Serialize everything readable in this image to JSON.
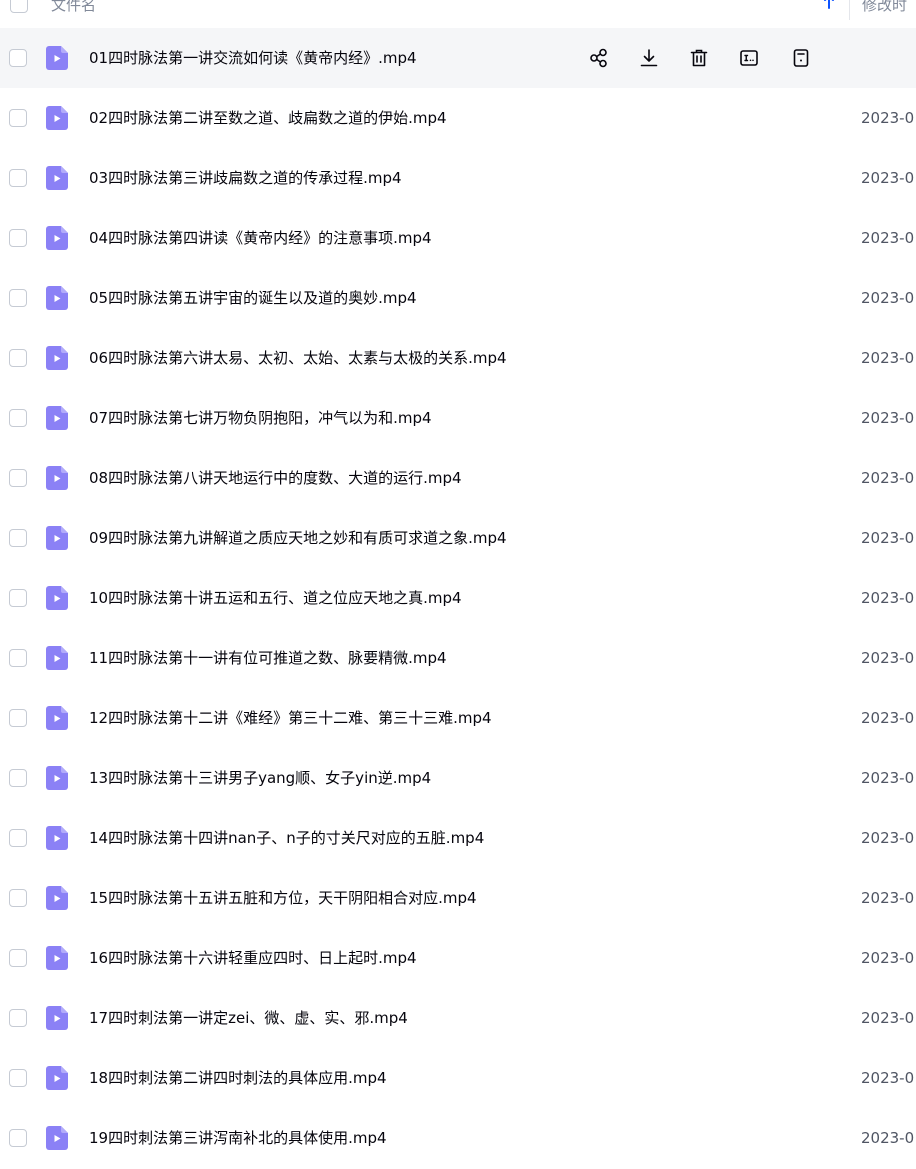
{
  "header": {
    "name_label": "文件名",
    "time_label": "修改时"
  },
  "colors": {
    "icon_bg": "#8b81f6",
    "accent": "#0d53ff",
    "hover_row": "#f5f6f8"
  },
  "icons": {
    "file": "video-file-icon",
    "share": "share-icon",
    "download": "download-icon",
    "delete": "trash-icon",
    "rename": "rename-icon",
    "more": "more-icon",
    "sort": "arrow-up-icon"
  },
  "files": [
    {
      "name": "01四时脉法第一讲交流如何读《黄帝内经》.mp4",
      "date": ""
    },
    {
      "name": "02四时脉法第二讲至数之道、歧扁数之道的伊始.mp4",
      "date": "2023-0"
    },
    {
      "name": "03四时脉法第三讲歧扁数之道的传承过程.mp4",
      "date": "2023-0"
    },
    {
      "name": "04四时脉法第四讲读《黄帝内经》的注意事项.mp4",
      "date": "2023-0"
    },
    {
      "name": "05四时脉法第五讲宇宙的诞生以及道的奥妙.mp4",
      "date": "2023-0"
    },
    {
      "name": "06四时脉法第六讲太易、太初、太始、太素与太极的关系.mp4",
      "date": "2023-0"
    },
    {
      "name": "07四时脉法第七讲万物负阴抱阳，冲气以为和.mp4",
      "date": "2023-0"
    },
    {
      "name": "08四时脉法第八讲天地运行中的度数、大道的运行.mp4",
      "date": "2023-0"
    },
    {
      "name": "09四时脉法第九讲解道之质应天地之妙和有质可求道之象.mp4",
      "date": "2023-0"
    },
    {
      "name": "10四时脉法第十讲五运和五行、道之位应天地之真.mp4",
      "date": "2023-0"
    },
    {
      "name": "11四时脉法第十一讲有位可推道之数、脉要精微.mp4",
      "date": "2023-0"
    },
    {
      "name": "12四时脉法第十二讲《难经》第三十二难、第三十三难.mp4",
      "date": "2023-0"
    },
    {
      "name": "13四时脉法第十三讲男子yang顺、女子yin逆.mp4",
      "date": "2023-0"
    },
    {
      "name": "14四时脉法第十四讲nan子、n子的寸关尺对应的五脏.mp4",
      "date": "2023-0"
    },
    {
      "name": "15四时脉法第十五讲五脏和方位，天干阴阳相合对应.mp4",
      "date": "2023-0"
    },
    {
      "name": "16四时脉法第十六讲轻重应四时、日上起时.mp4",
      "date": "2023-0"
    },
    {
      "name": "17四时刺法第一讲定zei、微、虚、实、邪.mp4",
      "date": "2023-0"
    },
    {
      "name": "18四时刺法第二讲四时刺法的具体应用.mp4",
      "date": "2023-0"
    },
    {
      "name": "19四时刺法第三讲泻南补北的具体使用.mp4",
      "date": "2023-0"
    }
  ]
}
